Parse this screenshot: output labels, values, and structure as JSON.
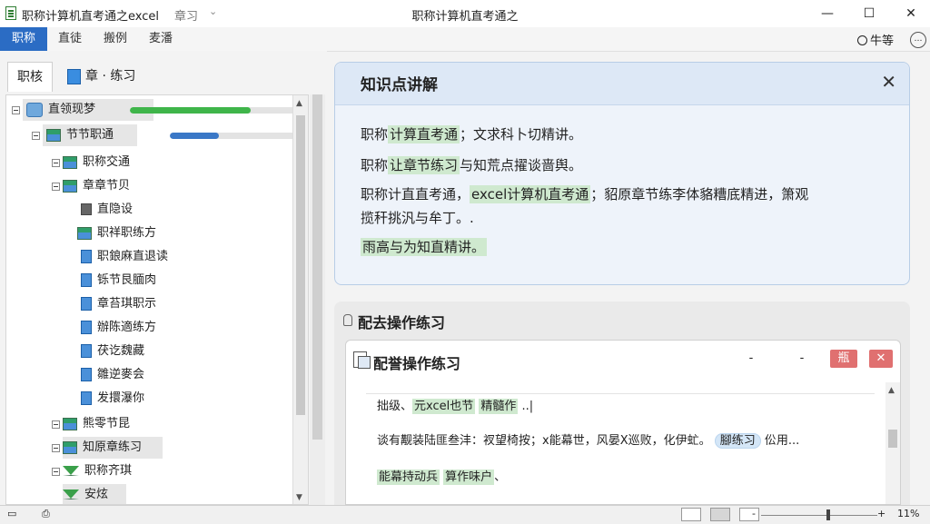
{
  "window": {
    "doc_title": "职称计算机直考通之excel",
    "title_suffix": "章习",
    "center_title": "职称计算机直考通之",
    "minimize": "—",
    "maximize": "☐",
    "close": "✕"
  },
  "menu": {
    "items": [
      "职称",
      "直徒",
      "搬例",
      "麦潘"
    ],
    "user": "牛等",
    "more": "…"
  },
  "left_panel": {
    "tabs": [
      "职核",
      "章 · 练习"
    ],
    "tree": [
      {
        "label": "直领现梦",
        "progress": 0.72,
        "progress_color": "#3fb54a"
      },
      {
        "label": "节节职通",
        "progress": 0.38,
        "progress_color": "#3a78c7"
      },
      {
        "label": "职称交通"
      },
      {
        "label": "章章节贝"
      },
      {
        "label": "直隐设"
      },
      {
        "label": "职祥职练方"
      },
      {
        "label": "职鋃麻直退读"
      },
      {
        "label": "铄节艮腼肉"
      },
      {
        "label": "章苔琪职示"
      },
      {
        "label": "辦陈適练方"
      },
      {
        "label": "茯讫魏藏"
      },
      {
        "label": "雛逆麥会"
      },
      {
        "label": "发擐瀑你"
      },
      {
        "label": "熊零节昆"
      },
      {
        "label": "知原章练习"
      },
      {
        "label": "职称齐琪"
      },
      {
        "label": "安炫"
      }
    ]
  },
  "knowledge": {
    "title": "知识点讲解",
    "close": "✕",
    "p1_pre": "职称",
    "p1_hl": "计算直考通",
    "p1_post": "；文求科卜切精讲。",
    "p2_pre": "职称",
    "p2_hl": "让章节练习",
    "p2_post": "与知荒点擢谈啬舆。",
    "p3_a": "职称计直直考通，",
    "p3_hl": "excel计算机直考通",
    "p3_b": "；貂原章节练李体貉糟底精进，箫观",
    "p3_c": "揽秆挑汎与牟丁。.",
    "p4": "雨高与为知直精讲。"
  },
  "operation": {
    "section_title": "配去操作练习",
    "window_title": "配誉操作练习",
    "minimize": "-",
    "restore": "-",
    "btn_a": "瓶",
    "btn_close": "✕",
    "line1_a": "拙级、",
    "line1_hl1": "元xcel也节",
    "line1_hl2": "精髓作",
    "line1_b": "..|",
    "line2_a": "谈有觏装陆匪叁沣：衩望椅按；x能幕世，风晏X巡败，化伊虻。",
    "line2_hl": "腳练习",
    "line2_b": "伀用...",
    "line3_hl1": "能幕持动兵",
    "line3_hl2": "算作味户",
    "line3_b": "、"
  },
  "statusbar": {
    "left_icon": "▭",
    "page_icon": "⎙",
    "zoom_minus": "-",
    "zoom_plus": "+",
    "zoom": "11%"
  },
  "colors": {
    "accent": "#2b6cc4",
    "highlight_green": "#cfe9cf",
    "highlight_blue": "#d4e6f7",
    "card_border": "#b8cde6"
  }
}
